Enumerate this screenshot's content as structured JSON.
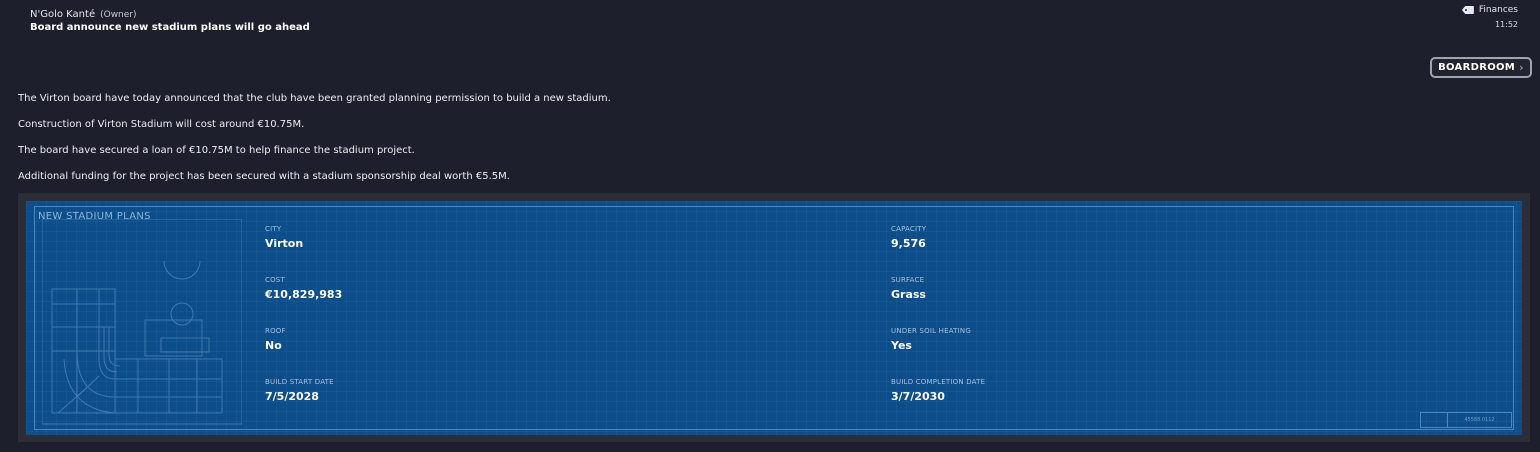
{
  "header": {
    "sender_name": "N'Golo Kanté",
    "sender_role": "(Owner)",
    "subject": "Board announce new stadium plans will go ahead",
    "category_icon": "tag-icon",
    "category": "Finances",
    "time": "11:52"
  },
  "actions": {
    "boardroom_label": "BOARDROOM",
    "boardroom_icon": "chevron-right-icon"
  },
  "body": {
    "paragraphs": [
      "The Virton board have today announced that the club have been granted planning permission to build a new stadium.",
      "Construction of Virton Stadium will cost around €10.75M.",
      "The board have secured a loan of €10.75M to help finance the stadium project.",
      "Additional funding for the project has been secured with a stadium sponsorship deal worth €5.5M."
    ]
  },
  "stadium_plans": {
    "title": "NEW STADIUM PLANS",
    "city": {
      "label": "CITY",
      "value": "Virton"
    },
    "capacity": {
      "label": "CAPACITY",
      "value": "9,576"
    },
    "cost": {
      "label": "COST",
      "value": "€10,829,983"
    },
    "surface": {
      "label": "SURFACE",
      "value": "Grass"
    },
    "roof": {
      "label": "ROOF",
      "value": "No"
    },
    "under_soil_heating": {
      "label": "UNDER SOIL HEATING",
      "value": "Yes"
    },
    "build_start_date": {
      "label": "BUILD START DATE",
      "value": "7/5/2028"
    },
    "build_completion_date": {
      "label": "BUILD COMPLETION DATE",
      "value": "3/7/2030"
    },
    "serial": "45588.0112"
  },
  "colors": {
    "background": "#1e1f2c",
    "panel_blue": "#0c4d8a",
    "blueprint_line": "#4e84bf"
  }
}
